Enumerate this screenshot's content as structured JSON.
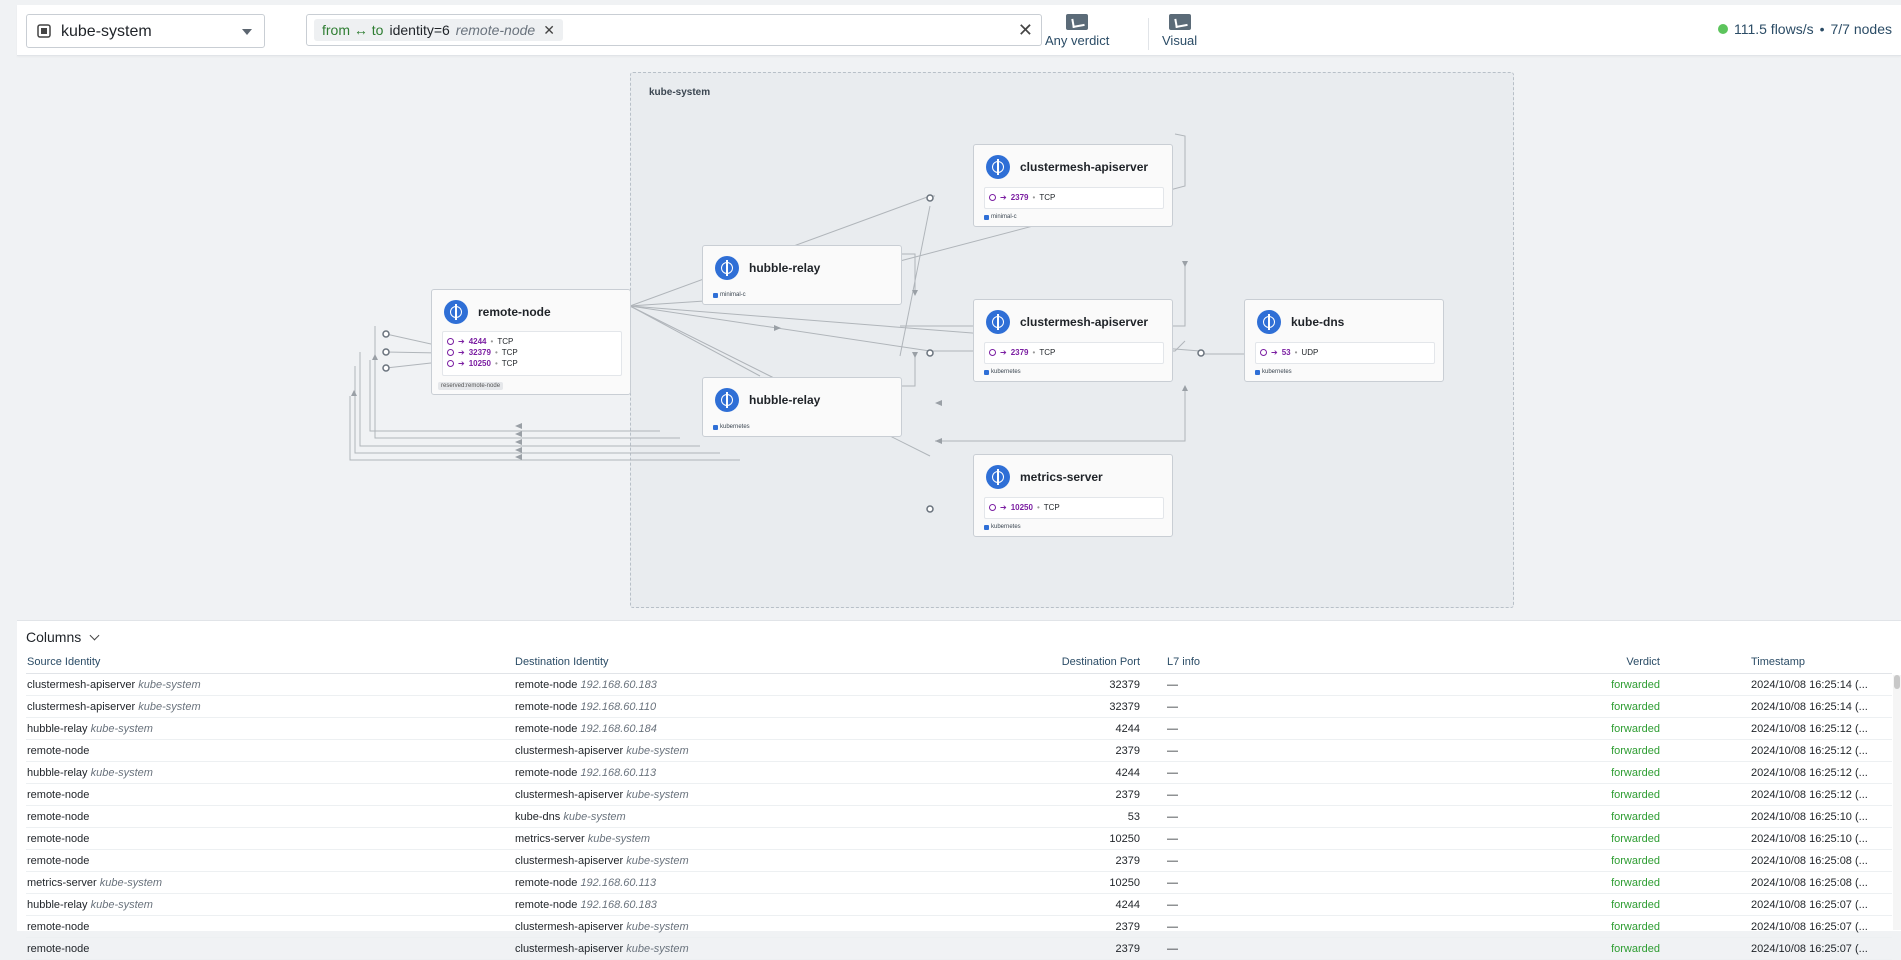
{
  "topbar": {
    "namespace": "kube-system",
    "filter": {
      "direction": "from ↔ to",
      "key": "identity=6",
      "value": "remote-node",
      "remove": "✕"
    },
    "clear": "✕",
    "verdict_label": "Any verdict",
    "visual_label": "Visual",
    "flows_rate": "111.5 flows/s",
    "separator": "•",
    "nodes": "7/7 nodes"
  },
  "map": {
    "namespace_label": "kube-system",
    "cards": {
      "remote_node": {
        "title": "remote-node",
        "ports": [
          {
            "num": "4244",
            "proto": "TCP"
          },
          {
            "num": "32379",
            "proto": "TCP"
          },
          {
            "num": "10250",
            "proto": "TCP"
          }
        ],
        "tag": "reserved:remote-node"
      },
      "hubble_relay_1": {
        "title": "hubble-relay",
        "label": "minimal-c"
      },
      "hubble_relay_2": {
        "title": "hubble-relay",
        "label": "kubernetes"
      },
      "cm_api_1": {
        "title": "clustermesh-apiserver",
        "ports": [
          {
            "num": "2379",
            "proto": "TCP"
          }
        ],
        "label": "minimal-c"
      },
      "cm_api_2": {
        "title": "clustermesh-apiserver",
        "ports": [
          {
            "num": "2379",
            "proto": "TCP"
          }
        ],
        "label": "kubernetes"
      },
      "metrics": {
        "title": "metrics-server",
        "ports": [
          {
            "num": "10250",
            "proto": "TCP"
          }
        ],
        "label": "kubernetes"
      },
      "kube_dns": {
        "title": "kube-dns",
        "ports": [
          {
            "num": "53",
            "proto": "UDP"
          }
        ],
        "label": "kubernetes"
      }
    }
  },
  "table": {
    "columns_button": "Columns",
    "headers": [
      "Source Identity",
      "Destination Identity",
      "Destination Port",
      "L7 info",
      "Verdict",
      "Timestamp"
    ],
    "rows": [
      {
        "src": "clustermesh-apiserver",
        "src_ns": "kube-system",
        "dst": "remote-node",
        "dst_ns": "192.168.60.183",
        "port": "32379",
        "l7": "—",
        "verdict": "forwarded",
        "ts": "2024/10/08 16:25:14 (..."
      },
      {
        "src": "clustermesh-apiserver",
        "src_ns": "kube-system",
        "dst": "remote-node",
        "dst_ns": "192.168.60.110",
        "port": "32379",
        "l7": "—",
        "verdict": "forwarded",
        "ts": "2024/10/08 16:25:14 (..."
      },
      {
        "src": "hubble-relay",
        "src_ns": "kube-system",
        "dst": "remote-node",
        "dst_ns": "192.168.60.184",
        "port": "4244",
        "l7": "—",
        "verdict": "forwarded",
        "ts": "2024/10/08 16:25:12 (..."
      },
      {
        "src": "remote-node",
        "src_ns": "",
        "dst": "clustermesh-apiserver",
        "dst_ns": "kube-system",
        "port": "2379",
        "l7": "—",
        "verdict": "forwarded",
        "ts": "2024/10/08 16:25:12 (..."
      },
      {
        "src": "hubble-relay",
        "src_ns": "kube-system",
        "dst": "remote-node",
        "dst_ns": "192.168.60.113",
        "port": "4244",
        "l7": "—",
        "verdict": "forwarded",
        "ts": "2024/10/08 16:25:12 (..."
      },
      {
        "src": "remote-node",
        "src_ns": "",
        "dst": "clustermesh-apiserver",
        "dst_ns": "kube-system",
        "port": "2379",
        "l7": "—",
        "verdict": "forwarded",
        "ts": "2024/10/08 16:25:12 (..."
      },
      {
        "src": "remote-node",
        "src_ns": "",
        "dst": "kube-dns",
        "dst_ns": "kube-system",
        "port": "53",
        "l7": "—",
        "verdict": "forwarded",
        "ts": "2024/10/08 16:25:10 (..."
      },
      {
        "src": "remote-node",
        "src_ns": "",
        "dst": "metrics-server",
        "dst_ns": "kube-system",
        "port": "10250",
        "l7": "—",
        "verdict": "forwarded",
        "ts": "2024/10/08 16:25:10 (..."
      },
      {
        "src": "remote-node",
        "src_ns": "",
        "dst": "clustermesh-apiserver",
        "dst_ns": "kube-system",
        "port": "2379",
        "l7": "—",
        "verdict": "forwarded",
        "ts": "2024/10/08 16:25:08 (..."
      },
      {
        "src": "metrics-server",
        "src_ns": "kube-system",
        "dst": "remote-node",
        "dst_ns": "192.168.60.113",
        "port": "10250",
        "l7": "—",
        "verdict": "forwarded",
        "ts": "2024/10/08 16:25:08 (..."
      },
      {
        "src": "hubble-relay",
        "src_ns": "kube-system",
        "dst": "remote-node",
        "dst_ns": "192.168.60.183",
        "port": "4244",
        "l7": "—",
        "verdict": "forwarded",
        "ts": "2024/10/08 16:25:07 (..."
      },
      {
        "src": "remote-node",
        "src_ns": "",
        "dst": "clustermesh-apiserver",
        "dst_ns": "kube-system",
        "port": "2379",
        "l7": "—",
        "verdict": "forwarded",
        "ts": "2024/10/08 16:25:07 (..."
      },
      {
        "src": "remote-node",
        "src_ns": "",
        "dst": "clustermesh-apiserver",
        "dst_ns": "kube-system",
        "port": "2379",
        "l7": "—",
        "verdict": "forwarded",
        "ts": "2024/10/08 16:25:07 (..."
      }
    ]
  }
}
